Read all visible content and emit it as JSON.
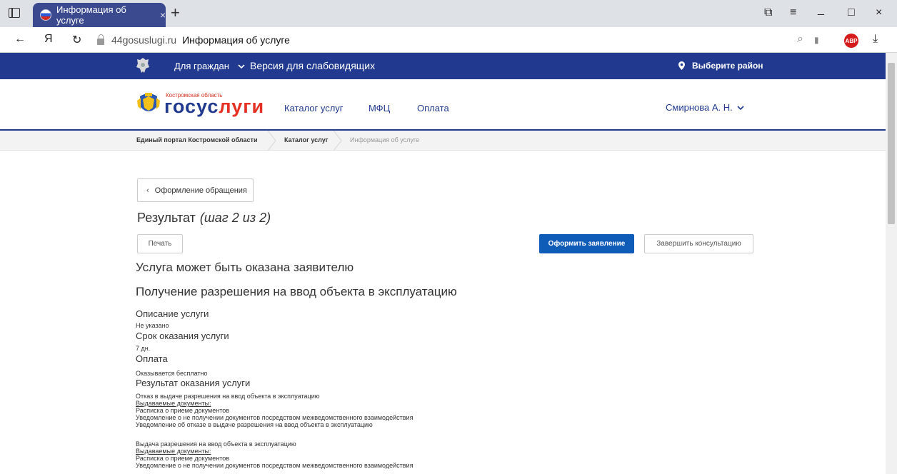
{
  "browser": {
    "tab_title": "Информация об услуге",
    "tab_close": "×",
    "new_tab": "+",
    "url_host": "44gosuslugi.ru",
    "url_title": "Информация об услуге",
    "abp_label": "ABP",
    "back_glyph": "←",
    "yandex_glyph": "Я",
    "reload_glyph": "↻",
    "download_glyph": "⤓",
    "search_glyph": "⌕",
    "bookmark_glyph": "▮",
    "menu_glyph": "≡",
    "minimize_glyph": "_",
    "maximize_glyph": "□",
    "close_glyph": "×",
    "pin_glyph": "⧉"
  },
  "topnav": {
    "citizens": "Для граждан",
    "visually_impaired": "Версия для слабовидящих",
    "region": "Выберите район"
  },
  "header": {
    "logo_region": "Костромская область",
    "logo_word_a": "госус",
    "logo_word_b": "луги",
    "nav": [
      "Каталог услуг",
      "МФЦ",
      "Оплата"
    ],
    "user": "Смирнова А. Н."
  },
  "breadcrumb": [
    "Единый портал Костромской области",
    "Каталог услуг",
    "Информация об услуге"
  ],
  "content": {
    "back_button": "Оформление обращения",
    "result": "Результат",
    "step": "(шаг 2 из 2)",
    "print": "Печать",
    "apply": "Оформить заявление",
    "finish": "Завершить консультацию",
    "availability": "Услуга может быть оказана заявителю",
    "service_name": "Получение разрешения на ввод объекта в эксплуатацию",
    "desc_title": "Описание услуги",
    "desc_value": "Не указано",
    "term_title": "Срок оказания услуги",
    "term_value": "7 дн.",
    "payment_title": "Оплата",
    "payment_value": "Оказывается бесплатно",
    "result_title": "Результат оказания услуги",
    "results": [
      {
        "title": "Отказ в выдаче разрешения на ввод объекта в эксплуатацию",
        "docs_label": "Выдаваемые документы:",
        "docs": [
          "Расписка о приеме документов",
          "Уведомление о не получении документов посредством межведомственного взаимодействия",
          "Уведомление об отказе в выдаче разрешения на ввод объекта в эксплуатацию"
        ]
      },
      {
        "title": "Выдача разрешения на ввод объекта в эксплуатацию",
        "docs_label": "Выдаваемые документы:",
        "docs": [
          "Расписка о приеме документов",
          "Уведомление о не получении документов посредством межведомственного взаимодействия"
        ]
      }
    ]
  },
  "colors": {
    "brand_blue": "#213a8f",
    "primary_button": "#0f5bb8",
    "logo_red": "#e53024"
  }
}
